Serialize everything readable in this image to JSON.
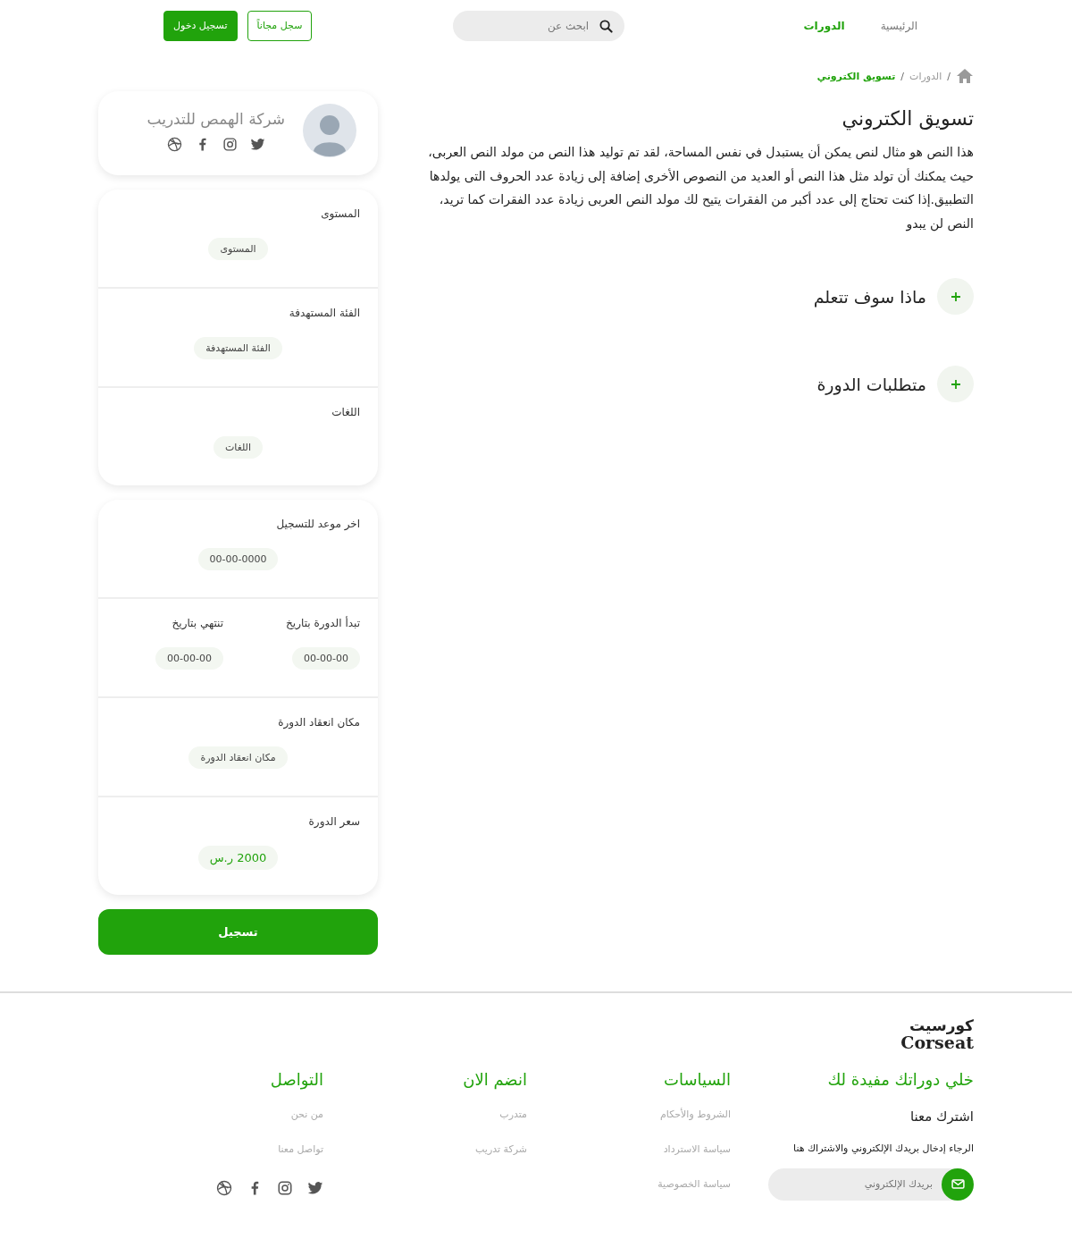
{
  "header": {
    "nav": [
      {
        "label": "الرئيسية",
        "selected": false
      },
      {
        "label": "الدورات",
        "selected": true
      }
    ],
    "search": {
      "placeholder": "ابحث عن"
    },
    "buttons": [
      {
        "label": "سجل مجاناً",
        "kind": "outline"
      },
      {
        "label": "تسجيل دخول",
        "kind": "filled"
      }
    ]
  },
  "breadcrumb": [
    {
      "separator": "/",
      "label": "الدورات",
      "current": false
    },
    {
      "separator": "/",
      "label": "تسويق الكتروني",
      "current": true
    }
  ],
  "course": {
    "title": "تسويق الكتروني",
    "description": "هذا النص هو مثال لنص يمكن أن يستبدل في نفس المساحة، لقد تم توليد هذا النص من مولد النص العربى، حيث يمكنك أن تولد مثل هذا النص أو العديد من النصوص الأخرى إضافة إلى زيادة عدد الحروف التى يولدها التطبيق.إذا كنت تحتاج إلى عدد أكبر من الفقرات يتيح لك مولد النص العربى زيادة عدد الفقرات كما تريد، النص لن يبدو",
    "accordions": [
      {
        "label": "ماذا سوف تتعلم"
      },
      {
        "label": "متطلبات الدورة"
      }
    ]
  },
  "provider": {
    "name": "شركة الهمص للتدريب"
  },
  "info_card": [
    {
      "fields": [
        {
          "label": "المستوى",
          "value": "المستوى",
          "kind": "text"
        }
      ]
    },
    {
      "fields": [
        {
          "label": "الفئة المستهدفة",
          "value": "الفئة المستهدفة",
          "kind": "text"
        }
      ]
    },
    {
      "fields": [
        {
          "label": "اللغات",
          "value": "اللغات",
          "kind": "text"
        }
      ]
    }
  ],
  "schedule_card": [
    {
      "fields": [
        {
          "label": "اخر موعد للتسجيل",
          "value": "00-00-0000",
          "kind": "text"
        }
      ]
    },
    {
      "fields": [
        {
          "label": "تبدأ الدورة بتاريخ",
          "value": "00-00-00",
          "kind": "text"
        },
        {
          "label": "تنتهي بتاريخ",
          "value": "00-00-00",
          "kind": "text"
        }
      ]
    },
    {
      "fields": [
        {
          "label": "مكان انعقاد الدورة",
          "value": "مكان انعقاد الدورة",
          "kind": "text"
        }
      ]
    },
    {
      "fields": [
        {
          "label": "سعر الدورة",
          "value": "2000 ر.س",
          "kind": "price"
        }
      ]
    }
  ],
  "register_button": "تسجيل",
  "footer": {
    "logo": {
      "arabic": "كورسيت",
      "latin": "Corseat"
    },
    "subscribe": {
      "title": "خلي دوراتك مفيدة لك",
      "subtitle": "اشترك معنا",
      "note": "الرجاء إدخال بريدك الإلكتروني والاشتراك هنا",
      "placeholder": "بريدك الإلكتروني"
    },
    "columns": [
      {
        "title": "السياسات",
        "links": [
          "الشروط والأحكام",
          "سياسة الاسترداد",
          "سياسة الخصوصية"
        ]
      },
      {
        "title": "انضم الان",
        "links": [
          "متدرب",
          "شركة تدريب"
        ]
      },
      {
        "title": "التواصل",
        "links": [
          "من نحن",
          "تواصل معنا"
        ]
      }
    ]
  }
}
